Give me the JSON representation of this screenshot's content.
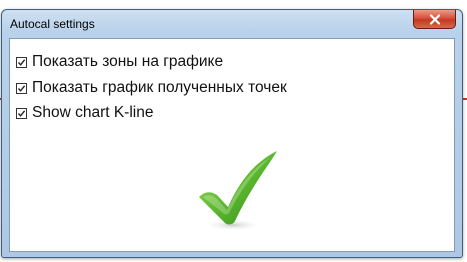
{
  "window": {
    "title": "Autocal settings",
    "close_label": "x"
  },
  "options": [
    {
      "label": "Показать зоны на графике",
      "checked": true
    },
    {
      "label": "Показать график полученных точек",
      "checked": true
    },
    {
      "label": "Show chart K-line",
      "checked": true
    }
  ],
  "icons": {
    "close": "close-icon",
    "check": "check-icon",
    "confirmation": "green-checkmark-icon"
  },
  "colors": {
    "title_bar": "#b9d1ea",
    "close_button": "#c13a22",
    "checkmark": "#5cb82e"
  }
}
